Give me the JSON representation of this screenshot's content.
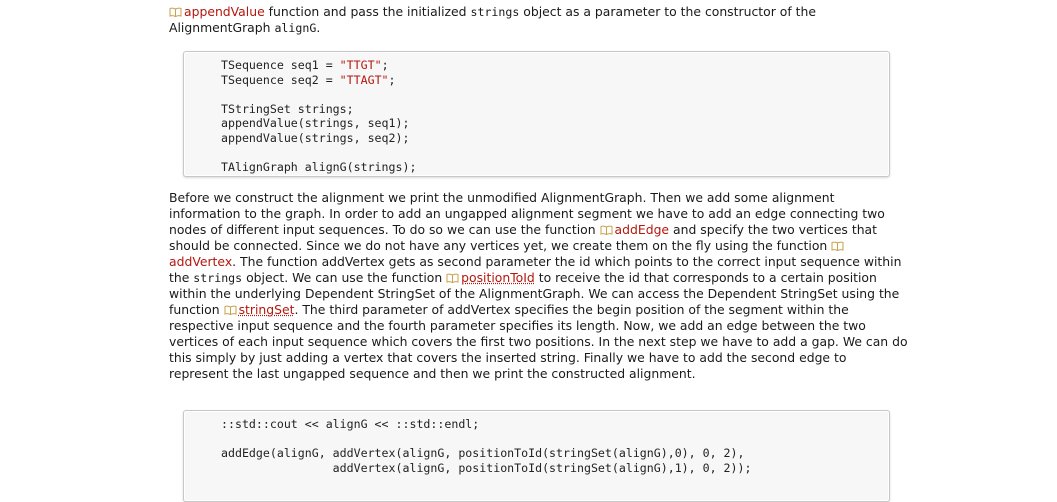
{
  "intro": {
    "link_appendValue": "appendValue",
    "text_after_link": " function and pass the initialized ",
    "strings_word": "strings",
    "text_after_strings": " object as a parameter to the constructor of the",
    "line2_prefix": "AlignmentGraph ",
    "aligng_word": "alignG",
    "line2_suffix": "."
  },
  "code_block_1": {
    "lines": [
      {
        "pre": "TSequence seq1 = ",
        "str": "\"TTGT\"",
        "post": ";"
      },
      {
        "pre": "TSequence seq2 = ",
        "str": "\"TTAGT\"",
        "post": ";"
      },
      {
        "pre": "",
        "str": "",
        "post": ""
      },
      {
        "pre": "TStringSet strings;",
        "str": "",
        "post": ""
      },
      {
        "pre": "appendValue(strings, seq1);",
        "str": "",
        "post": ""
      },
      {
        "pre": "appendValue(strings, seq2);",
        "str": "",
        "post": ""
      },
      {
        "pre": "",
        "str": "",
        "post": ""
      },
      {
        "pre": "TAlignGraph alignG(strings);",
        "str": "",
        "post": ""
      }
    ]
  },
  "main_paragraph": {
    "s1": "Before we construct the alignment we print the unmodified AlignmentGraph. Then we add some alignment information to the graph. In order to add an ungapped alignment segment we have to add an edge connecting two nodes of different input sequences. To do so we can use the function ",
    "link_addEdge": "addEdge",
    "s2": " and specify the two vertices that should be connected. Since we do not have any vertices yet, we create them on the fly using the function ",
    "link_addVertex": "addVertex",
    "s3": ". The function addVertex gets as second parameter the id which points to the correct input sequence within the ",
    "strings_word": "strings",
    "s4": " object. We can use the function ",
    "link_positionToId": "positionToId",
    "s5": " to receive the id that corresponds to a certain position within the underlying Dependent StringSet of the AlignmentGraph. We can access the Dependent StringSet using the function ",
    "link_stringSet": "stringSet",
    "s6": ". The third parameter of addVertex specifies the begin position of the segment within the respective input sequence and the fourth parameter specifies its length. Now, we add an edge between the two vertices of each input sequence which covers the first two positions. In the next step we have to add a gap. We can do this simply by just adding a vertex that covers the inserted string. Finally we have to add the second edge to represent the last ungapped sequence and then we print the constructed alignment."
  },
  "code_block_2": {
    "lines": [
      "::std::cout << alignG << ::std::endl;",
      "",
      "addEdge(alignG, addVertex(alignG, positionToId(stringSet(alignG),0), 0, 2),",
      "                addVertex(alignG, positionToId(stringSet(alignG),1), 0, 2));"
    ]
  },
  "colors": {
    "link": "#b3170e",
    "code_background": "#f7f7f7",
    "code_border": "#c8c8c8"
  },
  "icons": {
    "link_icon": "book-icon"
  }
}
